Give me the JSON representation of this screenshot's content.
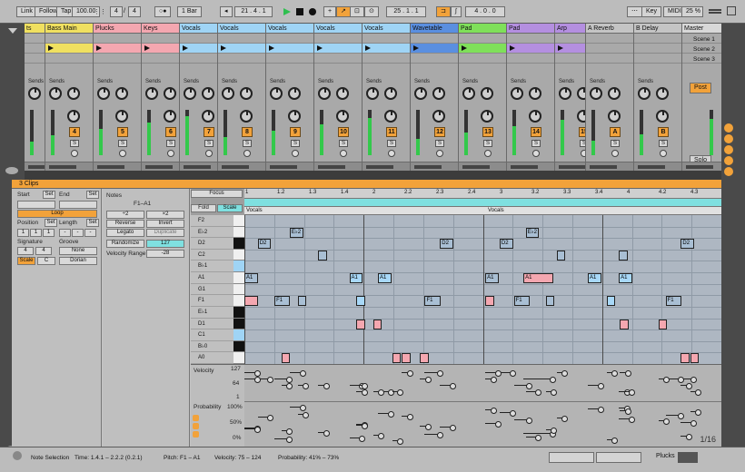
{
  "transport": {
    "link": "Link",
    "follow": "Follow",
    "tap": "Tap",
    "tempo": "100.00",
    "sig_num": "4",
    "sig_sep": "/",
    "sig_den": "4",
    "quantize": "1 Bar",
    "position": "21 . 4 . 1",
    "loop_start": "25 . 1 . 1",
    "loop_len": "4 . 0 . 0",
    "key_label": "Key",
    "midi_label": "MIDI",
    "cpu": "25 %"
  },
  "tracks": [
    {
      "name": "ts",
      "color": "#f0e060",
      "num": ""
    },
    {
      "name": "Bass Main",
      "color": "#f0e060",
      "num": "4"
    },
    {
      "name": "Plucks",
      "color": "#f4a7b0",
      "num": "5"
    },
    {
      "name": "Keys",
      "color": "#f4a7b0",
      "num": "6"
    },
    {
      "name": "Vocals",
      "color": "#9fd4f5",
      "num": "7"
    },
    {
      "name": "Vocals",
      "color": "#9fd4f5",
      "num": "8"
    },
    {
      "name": "Vocals",
      "color": "#9fd4f5",
      "num": "9"
    },
    {
      "name": "Vocals",
      "color": "#9fd4f5",
      "num": "10"
    },
    {
      "name": "Vocals",
      "color": "#9fd4f5",
      "num": "11"
    },
    {
      "name": "Wavetable",
      "color": "#5a8fe0",
      "num": "12"
    },
    {
      "name": "Pad",
      "color": "#7fe05a",
      "num": "13"
    },
    {
      "name": "Pad",
      "color": "#b48fe0",
      "num": "14"
    },
    {
      "name": "Arp",
      "color": "#b48fe0",
      "num": "15"
    },
    {
      "name": "A Reverb",
      "color": "#c4c4c4",
      "num": "A"
    },
    {
      "name": "B Delay",
      "color": "#c4c4c4",
      "num": "B"
    },
    {
      "name": "Master",
      "color": "#d8d8d8",
      "num": ""
    }
  ],
  "mixer": {
    "sends": "Sends",
    "post": "Post",
    "solo": "Solo",
    "scenes": [
      "Scene 1",
      "Scene 2",
      "Scene 3"
    ]
  },
  "clip": {
    "title": "3 Clips",
    "start": "Start",
    "end": "End",
    "set": "Set",
    "loop": "Loop",
    "position": "Position",
    "length": "Length",
    "pos_vals": [
      "1",
      "1",
      "1"
    ],
    "len_vals": [
      "-",
      "-",
      "-"
    ],
    "signature": "Signature",
    "groove": "Groove",
    "sig_vals": [
      "4",
      "4"
    ],
    "groove_val": "None",
    "scale": "Scale",
    "scale_root": "C",
    "scale_mode": "Dorian"
  },
  "notes": {
    "title": "Notes",
    "range": "F1–A1",
    "plus2": "÷2",
    "times2": "×2",
    "reverse": "Reverse",
    "invert": "Invert",
    "legato": "Legato",
    "duplicate": "Duplicate",
    "randomize": "Randomize",
    "rand_val": "127",
    "vel_range": "Velocity Range",
    "vel_range_val": "-28"
  },
  "editor": {
    "focus": "Focus",
    "fold": "Fold",
    "scale": "Scale",
    "clip_names": [
      "Vocals",
      "Vocals"
    ],
    "ruler": [
      "1",
      "1.2",
      "1.3",
      "1.4",
      "2",
      "2.2",
      "2.3",
      "2.4",
      "3",
      "3.2",
      "3.3",
      "3.4",
      "4",
      "4.2",
      "4.3"
    ],
    "pitches": [
      "F2",
      "E♭2",
      "D2",
      "C2",
      "B♭1",
      "A1",
      "G1",
      "F1",
      "E♭1",
      "D1",
      "C1",
      "B♭0",
      "A0"
    ],
    "velocity": "Velocity",
    "vel_scale": [
      "127",
      "64",
      "1"
    ],
    "probability": "Probability",
    "prob_scale": [
      "100%",
      "50%",
      "0%"
    ],
    "page": "1/16"
  },
  "note_list": [
    {
      "label": "E♭2",
      "x": 0.095,
      "r": 1,
      "w": 0.028,
      "t": "n"
    },
    {
      "label": "D2",
      "x": 0.028,
      "r": 2,
      "w": 0.028,
      "t": "n"
    },
    {
      "label": "D2",
      "x": 0.41,
      "r": 2,
      "w": 0.028,
      "t": "n"
    },
    {
      "label": "E♭2",
      "x": 0.59,
      "r": 1,
      "w": 0.028,
      "t": "n"
    },
    {
      "label": "D2",
      "x": 0.535,
      "r": 2,
      "w": 0.028,
      "t": "n"
    },
    {
      "label": "D2",
      "x": 0.915,
      "r": 2,
      "w": 0.028,
      "t": "n"
    },
    {
      "label": "",
      "x": 0.155,
      "r": 3,
      "w": 0.018,
      "t": "n"
    },
    {
      "label": "",
      "x": 0.785,
      "r": 3,
      "w": 0.018,
      "t": "n"
    },
    {
      "label": "",
      "x": 0.655,
      "r": 3,
      "w": 0.018,
      "t": "n"
    },
    {
      "label": "A1",
      "x": 0.0,
      "r": 5,
      "w": 0.028,
      "t": "n"
    },
    {
      "label": "A1",
      "x": 0.22,
      "r": 5,
      "w": 0.028,
      "t": "sel"
    },
    {
      "label": "A1",
      "x": 0.28,
      "r": 5,
      "w": 0.028,
      "t": "sel"
    },
    {
      "label": "A1",
      "x": 0.505,
      "r": 5,
      "w": 0.028,
      "t": "n"
    },
    {
      "label": "A1",
      "x": 0.585,
      "r": 5,
      "w": 0.063,
      "t": "pink"
    },
    {
      "label": "A1",
      "x": 0.72,
      "r": 5,
      "w": 0.028,
      "t": "sel"
    },
    {
      "label": "A1",
      "x": 0.785,
      "r": 5,
      "w": 0.028,
      "t": "sel"
    },
    {
      "label": "",
      "x": 0.0,
      "r": 7,
      "w": 0.028,
      "t": "pink"
    },
    {
      "label": "F1",
      "x": 0.063,
      "r": 7,
      "w": 0.033,
      "t": "n"
    },
    {
      "label": "",
      "x": 0.112,
      "r": 7,
      "w": 0.018,
      "t": "n"
    },
    {
      "label": "",
      "x": 0.235,
      "r": 7,
      "w": 0.018,
      "t": "sel"
    },
    {
      "label": "F1",
      "x": 0.378,
      "r": 7,
      "w": 0.033,
      "t": "n"
    },
    {
      "label": "",
      "x": 0.505,
      "r": 7,
      "w": 0.018,
      "t": "pink"
    },
    {
      "label": "F1",
      "x": 0.565,
      "r": 7,
      "w": 0.033,
      "t": "n"
    },
    {
      "label": "",
      "x": 0.632,
      "r": 7,
      "w": 0.018,
      "t": "n"
    },
    {
      "label": "",
      "x": 0.76,
      "r": 7,
      "w": 0.018,
      "t": "sel"
    },
    {
      "label": "F1",
      "x": 0.883,
      "r": 7,
      "w": 0.033,
      "t": "n"
    },
    {
      "label": "",
      "x": 0.235,
      "r": 9,
      "w": 0.018,
      "t": "pink"
    },
    {
      "label": "",
      "x": 0.27,
      "r": 9,
      "w": 0.018,
      "t": "pink"
    },
    {
      "label": "",
      "x": 0.787,
      "r": 9,
      "w": 0.018,
      "t": "pink"
    },
    {
      "label": "",
      "x": 0.868,
      "r": 9,
      "w": 0.018,
      "t": "pink"
    },
    {
      "label": "",
      "x": 0.078,
      "r": 12,
      "w": 0.018,
      "t": "pink"
    },
    {
      "label": "",
      "x": 0.31,
      "r": 12,
      "w": 0.018,
      "t": "pink"
    },
    {
      "label": "",
      "x": 0.33,
      "r": 12,
      "w": 0.018,
      "t": "pink"
    },
    {
      "label": "",
      "x": 0.368,
      "r": 12,
      "w": 0.018,
      "t": "pink"
    },
    {
      "label": "",
      "x": 0.915,
      "r": 12,
      "w": 0.018,
      "t": "pink"
    },
    {
      "label": "",
      "x": 0.935,
      "r": 12,
      "w": 0.018,
      "t": "pink"
    }
  ],
  "status": {
    "title": "Note Selection",
    "time": "Time: 1.4.1 – 2.2.2 (0.2.1)",
    "pitch": "Pitch: F1 – A1",
    "velocity": "Velocity: 75 – 124",
    "probability": "Probability: 41% – 73%",
    "track": "Plucks"
  }
}
